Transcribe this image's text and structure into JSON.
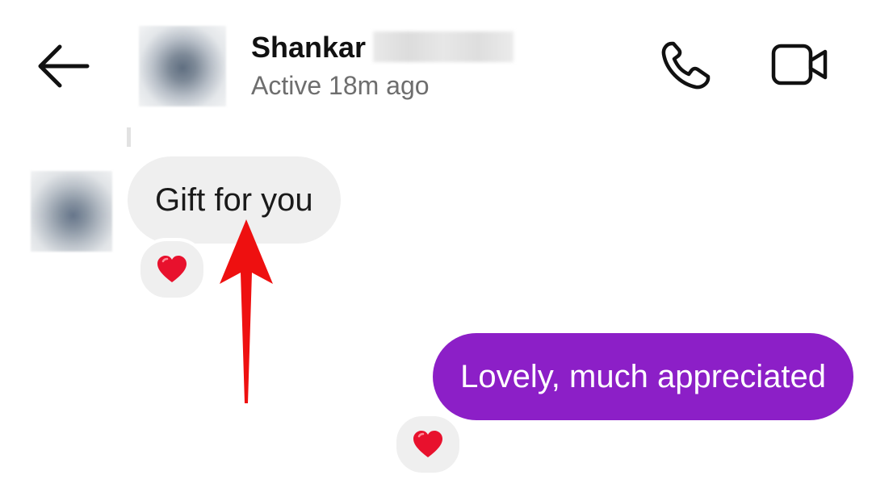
{
  "header": {
    "back_icon": "arrow-left-icon",
    "contact_name": "Shankar",
    "status": "Active 18m ago",
    "call_icon": "phone-icon",
    "video_icon": "video-camera-icon"
  },
  "messages": [
    {
      "direction": "incoming",
      "text": "Gift for you",
      "reaction": "❤️",
      "bubble_color": "#efefef"
    },
    {
      "direction": "outgoing",
      "text": "Lovely, much appreciated",
      "reaction": "❤️",
      "bubble_color": "#8c1fc7"
    }
  ],
  "colors": {
    "accent": "#8c1fc7",
    "annotation": "#ee1010",
    "heart": "#e8112d"
  }
}
